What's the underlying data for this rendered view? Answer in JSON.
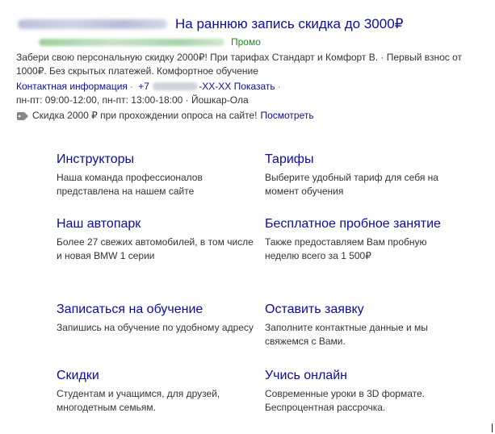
{
  "ad": {
    "title": "На раннюю запись скидка до 3000₽",
    "promo_label": "Промо",
    "description": "Забери свою персональную скидку 2000₽! При тарифах Стандарт и Комфорт В. · Первый взнос от 1000₽. Без скрытых платежей. Комфортное обучение",
    "contact_info_link": "Контактная информация",
    "phone_prefix": "+7",
    "phone_suffix": "-XX-XX",
    "show_link": "Показать",
    "hours": "пн-пт: 09:00-12:00, пн-пт: 13:00-18:00 · Йошкар-Ола",
    "promo_text": "Скидка 2000 ₽ при прохождении опроса на сайте!",
    "promo_link": "Посмотреть"
  },
  "sitelinks": [
    {
      "title": "Инструкторы",
      "description": "Наша команда профессионалов представлена на нашем сайте"
    },
    {
      "title": "Тарифы",
      "description": "Выберите удобный тариф для себя на момент обучения"
    },
    {
      "title": "Наш автопарк",
      "description": "Более 27 свежих автомобилей, в том числе и новая BMW 1 серии"
    },
    {
      "title": "Бесплатное пробное занятие",
      "description": "Также предоставляем Вам пробную неделю всего за 1 500₽"
    },
    {
      "title": "Записаться на обучение",
      "description": "Запишись на обучение по удобному адресу"
    },
    {
      "title": "Оставить заявку",
      "description": "Заполните контактные данные и мы свяжемся с Вами."
    },
    {
      "title": "Скидки",
      "description": "Студентам и учащимся, для друзей, многодетным семьям."
    },
    {
      "title": "Учись онлайн",
      "description": "Современные уроки в 3D формате. Беспроцентная рассрочка."
    }
  ],
  "colors": {
    "link": "#0b0ba8",
    "promo_green": "#1a8a1a",
    "text": "#333333"
  },
  "icons": {
    "promo_tag": "tag-icon"
  }
}
